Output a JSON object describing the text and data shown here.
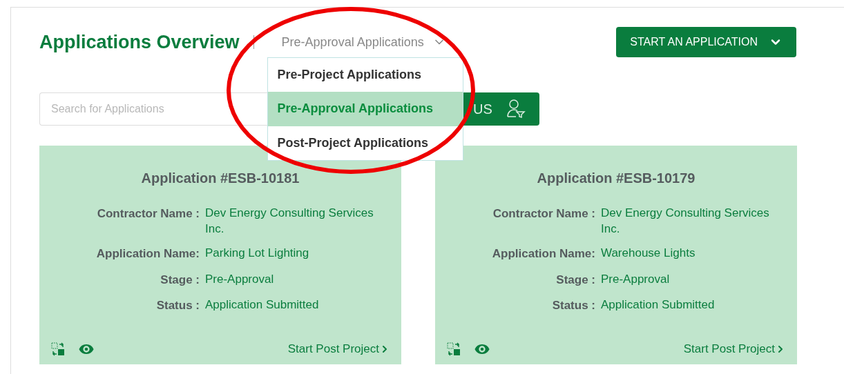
{
  "header": {
    "title": "Applications Overview",
    "filter_dropdown": {
      "value": "Pre-Approval Applications",
      "expanded": true,
      "options": [
        {
          "label": "Pre-Project Applications",
          "selected": false
        },
        {
          "label": "Pre-Approval Applications",
          "selected": true
        },
        {
          "label": "Post-Project Applications",
          "selected": false
        }
      ]
    },
    "start_button": "START AN APPLICATION"
  },
  "search": {
    "placeholder": "Search for Applications"
  },
  "status_button": {
    "label": "US"
  },
  "cards": [
    {
      "title": "Application #ESB-10181",
      "fields": [
        {
          "label": "Contractor Name :",
          "value": "Dev Energy Consulting Services Inc."
        },
        {
          "label": "Application Name:",
          "value": "Parking Lot Lighting"
        },
        {
          "label": "Stage :",
          "value": "Pre-Approval"
        },
        {
          "label": "Status :",
          "value": "Application Submitted"
        }
      ],
      "action": "Start Post Project"
    },
    {
      "title": "Application #ESB-10179",
      "fields": [
        {
          "label": "Contractor Name :",
          "value": "Dev Energy Consulting Services Inc."
        },
        {
          "label": "Application Name:",
          "value": "Warehouse Lights"
        },
        {
          "label": "Stage :",
          "value": "Pre-Approval"
        },
        {
          "label": "Status :",
          "value": "Application Submitted"
        }
      ],
      "action": "Start Post Project"
    }
  ]
}
